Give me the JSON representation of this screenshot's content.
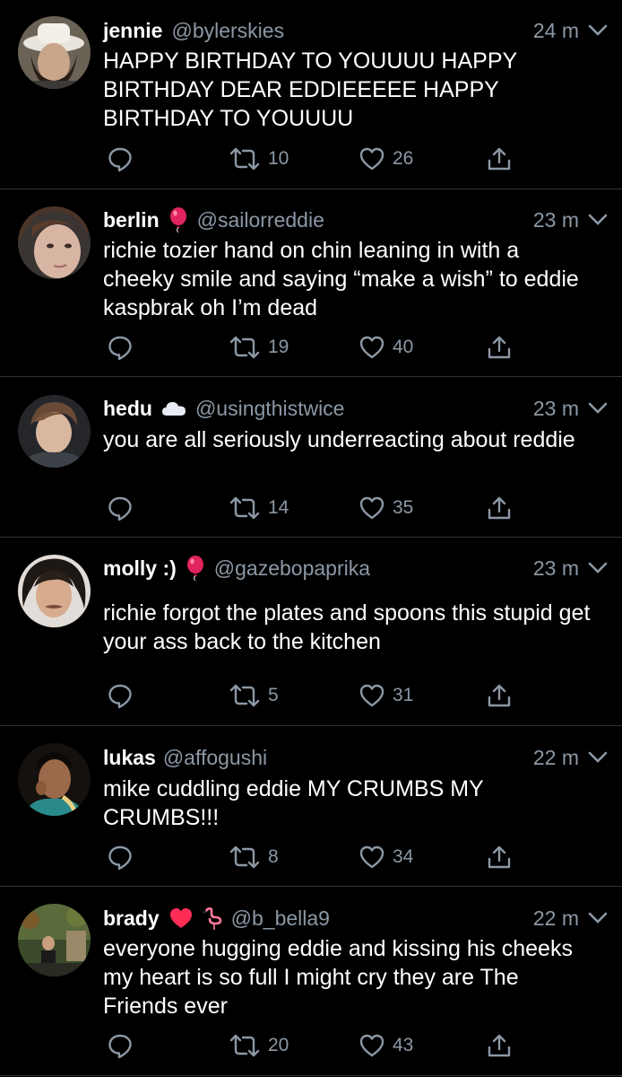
{
  "tweets": [
    {
      "name": "jennie",
      "handle": "@bylerskies",
      "badge": "",
      "time": "24 m",
      "text": "HAPPY BIRTHDAY TO YOUUUU HAPPY BIRTHDAY DEAR EDDIEEEEE HAPPY BIRTHDAY TO YOUUUU",
      "retweets": "10",
      "likes": "26"
    },
    {
      "name": "berlin",
      "handle": "@sailorreddie",
      "badge": "balloon-emoji",
      "time": "23 m",
      "text": "richie tozier hand on chin leaning in with a cheeky smile and saying “make a wish” to eddie kaspbrak oh I’m dead",
      "retweets": "19",
      "likes": "40"
    },
    {
      "name": "hedu",
      "handle": "@usingthistwice",
      "badge": "cloud-emoji",
      "time": "23 m",
      "text": "you are all seriously underreacting about reddie",
      "retweets": "14",
      "likes": "35"
    },
    {
      "name": "molly :)",
      "handle": "@gazebopaprika",
      "badge": "balloon-emoji",
      "time": "23 m",
      "text": "richie forgot the plates and spoons this stupid get your ass back to the kitchen",
      "retweets": "5",
      "likes": "31"
    },
    {
      "name": "lukas",
      "handle": "@affogushi",
      "badge": "",
      "time": "22 m",
      "text": "mike cuddling eddie MY CRUMBS MY CRUMBS!!!",
      "retweets": "8",
      "likes": "34"
    },
    {
      "name": "brady",
      "handle": "@b_bella9",
      "badge": "heart-flamingo-emoji",
      "time": "22 m",
      "text": "everyone hugging eddie and kissing his cheeks my heart is so full I might cry they are The Friends ever",
      "retweets": "20",
      "likes": "43"
    }
  ],
  "colors": {
    "background": "#000000",
    "text": "#ffffff",
    "muted": "#8b98a5",
    "divider": "#2f3336",
    "balloon": "#e0245e",
    "heart_emoji": "#ff2d55"
  }
}
